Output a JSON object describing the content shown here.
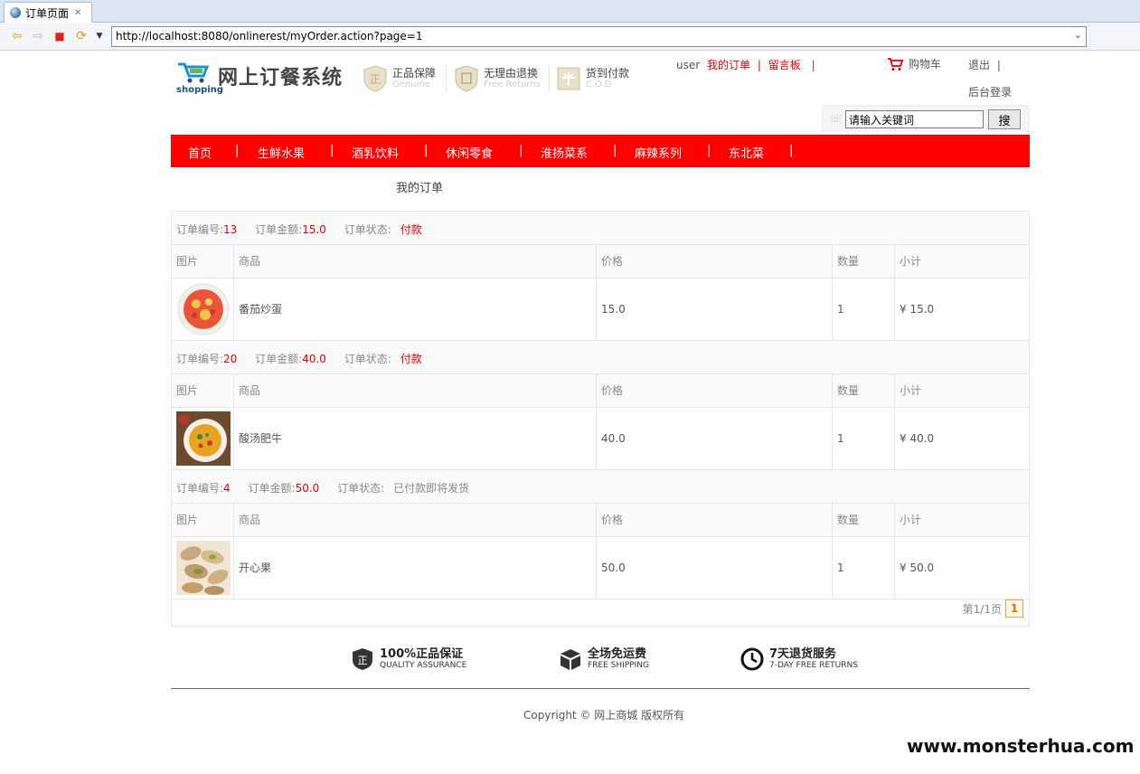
{
  "browser": {
    "tab_title": "订单页面",
    "url": "http://localhost:8080/onlinerest/myOrder.action?page=1"
  },
  "header": {
    "logo_small": "shopping",
    "logo_title": "网上订餐系统",
    "badges": [
      {
        "title": "正品保障",
        "sub": "Genuine",
        "icon_char": "正"
      },
      {
        "title": "无理由退换",
        "sub": "Free Returns",
        "icon_char": "退"
      },
      {
        "title": "货到付款",
        "sub": "C.O.D",
        "icon_char": "¥"
      }
    ],
    "user": "user",
    "my_orders": "我的订单",
    "separator": "|",
    "message_board": "留言板",
    "cart": "购物车",
    "logout": "退出",
    "admin_login": "后台登录"
  },
  "search": {
    "placeholder": "请输入关键词",
    "button": "搜"
  },
  "menu": [
    "首页",
    "生鲜水果",
    "酒乳饮料",
    "休闲零食",
    "淮扬菜系",
    "麻辣系列",
    "东北菜"
  ],
  "page_title": "我的订单",
  "order_labels": {
    "id": "订单编号:",
    "amount": "订单金额:",
    "status": "订单状态:"
  },
  "table_headers": [
    "图片",
    "商品",
    "价格",
    "数量",
    "小计"
  ],
  "orders": [
    {
      "id": "13",
      "amount": "15.0",
      "status": "付款",
      "status_color": "#dd0000",
      "item": {
        "name": "番茄炒蛋",
        "price": "15.0",
        "qty": "1",
        "subtotal": "¥ 15.0"
      }
    },
    {
      "id": "20",
      "amount": "40.0",
      "status": "付款",
      "status_color": "#dd0000",
      "item": {
        "name": "酸汤肥牛",
        "price": "40.0",
        "qty": "1",
        "subtotal": "¥ 40.0"
      }
    },
    {
      "id": "4",
      "amount": "50.0",
      "status": "已付款即将发货",
      "status_color": "#888888",
      "item": {
        "name": "开心果",
        "price": "50.0",
        "qty": "1",
        "subtotal": "¥ 50.0"
      }
    }
  ],
  "pager": {
    "text": "第1/1页",
    "current": "1"
  },
  "features": [
    {
      "title": "100%正品保证",
      "sub": "QUALITY ASSURANCE"
    },
    {
      "title": "全场免运费",
      "sub": "FREE SHIPPING"
    },
    {
      "title": "7天退货服务",
      "sub": "7-DAY FREE RETURNS"
    }
  ],
  "copyright": "Copyright © 网上商城 版权所有",
  "watermark": "www.monsterhua.com",
  "colors": {
    "accent": "#ff0000",
    "price_red": "#dd0000"
  }
}
